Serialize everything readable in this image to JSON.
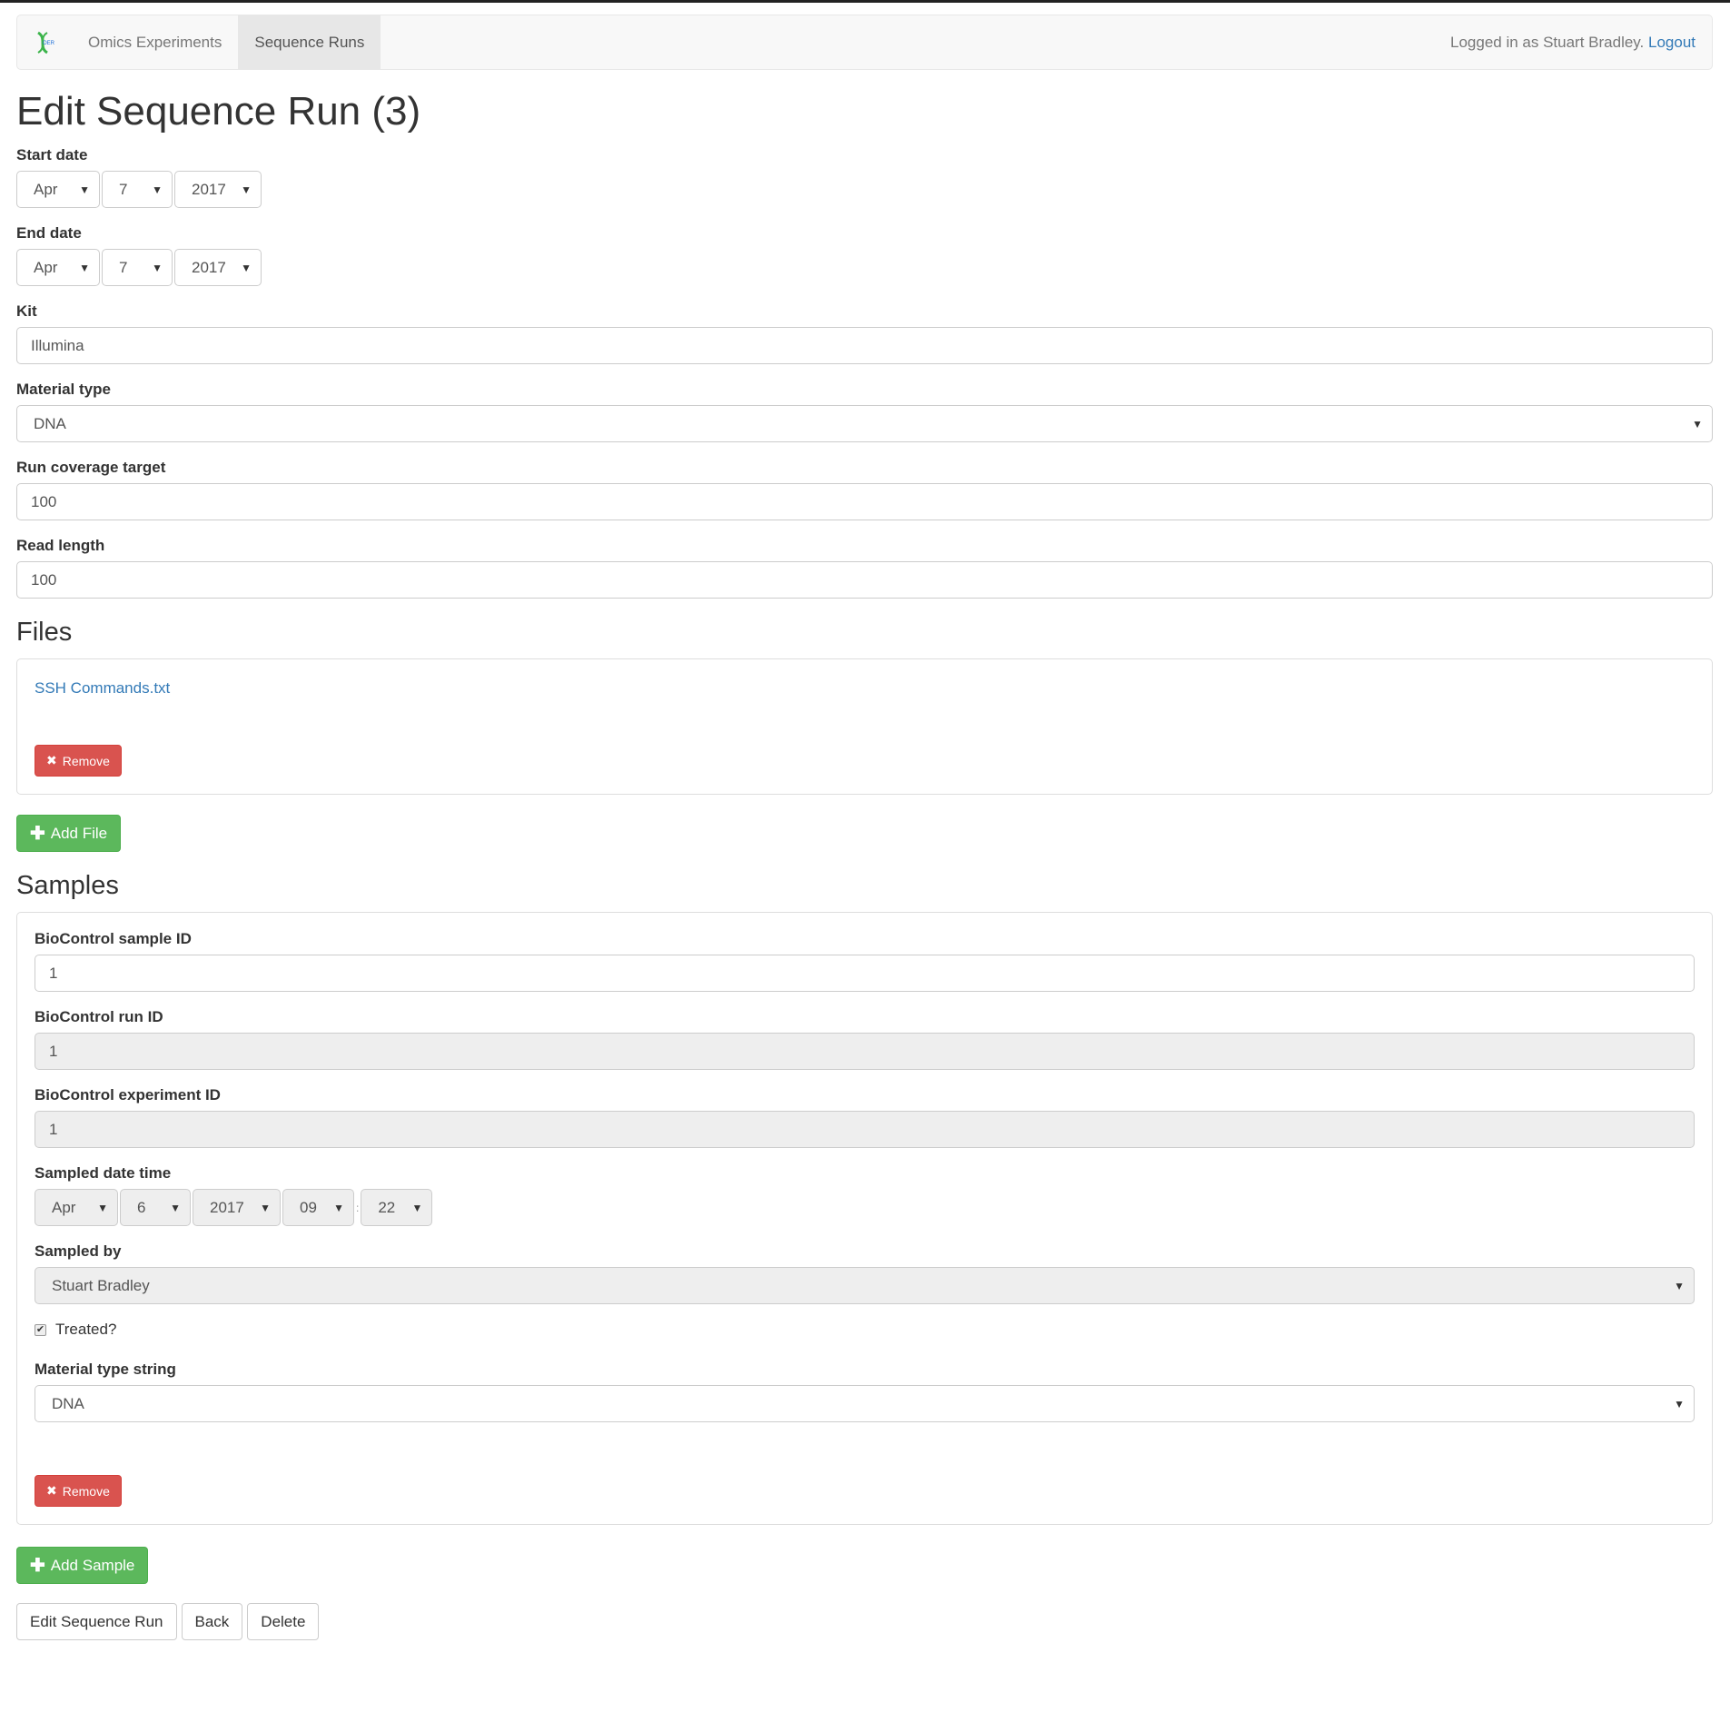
{
  "nav": {
    "brand_icon": "dna-logo-icon",
    "items": [
      {
        "label": "Omics Experiments",
        "active": false
      },
      {
        "label": "Sequence Runs",
        "active": true
      }
    ],
    "logged_in_text": "Logged in as Stuart Bradley.",
    "logout": "Logout"
  },
  "title": "Edit Sequence Run (3)",
  "start_date": {
    "label": "Start date",
    "month": "Apr",
    "day": "7",
    "year": "2017"
  },
  "end_date": {
    "label": "End date",
    "month": "Apr",
    "day": "7",
    "year": "2017"
  },
  "kit": {
    "label": "Kit",
    "value": "Illumina"
  },
  "material_type": {
    "label": "Material type",
    "value": "DNA"
  },
  "run_coverage": {
    "label": "Run coverage target",
    "value": "100"
  },
  "read_length": {
    "label": "Read length",
    "value": "100"
  },
  "files": {
    "heading": "Files",
    "items": [
      {
        "name": "SSH Commands.txt",
        "remove": "Remove"
      }
    ],
    "add": "Add File"
  },
  "samples": {
    "heading": "Samples",
    "items": [
      {
        "sample_id_label": "BioControl sample ID",
        "sample_id": "1",
        "run_id_label": "BioControl run ID",
        "run_id": "1",
        "exp_id_label": "BioControl experiment ID",
        "exp_id": "1",
        "sampled_label": "Sampled date time",
        "month": "Apr",
        "day": "6",
        "year": "2017",
        "hour": "09",
        "sep": ":",
        "minute": "22",
        "by_label": "Sampled by",
        "by": "Stuart Bradley",
        "treated_label": "Treated?",
        "treated": true,
        "mts_label": "Material type string",
        "mts": "DNA",
        "remove": "Remove"
      }
    ],
    "add": "Add Sample"
  },
  "actions": {
    "submit": "Edit Sequence Run",
    "back": "Back",
    "delete": "Delete"
  },
  "colors": {
    "danger": "#d9534f",
    "success": "#5cb85c",
    "link": "#337ab7"
  }
}
